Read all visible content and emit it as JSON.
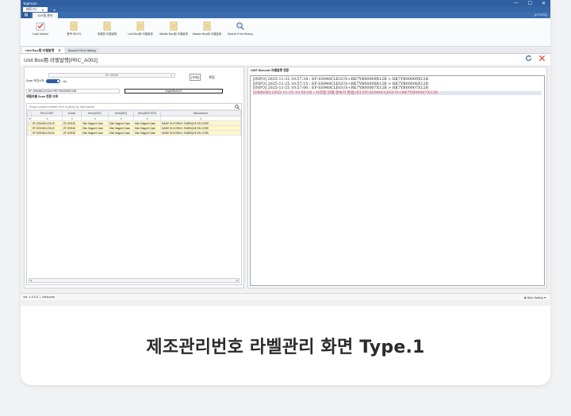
{
  "window": {
    "title": "TopFrom",
    "controls": [
      "—",
      "☐",
      "✕"
    ]
  },
  "doc_tabs": [
    {
      "label": "메모기1"
    }
  ],
  "ribbon_tab": "시스템 관리",
  "user": "(KTOPS)",
  "ribbon": [
    {
      "label": "Code Master",
      "icon": "check-doc-icon"
    },
    {
      "label": "품목 마스터",
      "icon": "doc-icon"
    },
    {
      "label": "제품別 라벨발행",
      "icon": "doc-icon"
    },
    {
      "label": "Unit Box用 라벨발행",
      "icon": "doc-icon"
    },
    {
      "label": "Middle Box用 라벨발행",
      "icon": "doc-icon"
    },
    {
      "label": "Master Box用 라벨발행",
      "icon": "doc-icon"
    },
    {
      "label": "Search Print History",
      "icon": "search-doc-icon"
    }
  ],
  "module_tabs": [
    {
      "label": "Unit Box用 라벨발행",
      "close": "✕"
    },
    {
      "label": "Search Print History"
    }
  ],
  "page": {
    "title": "Unit Box用 라벨발행[PRC_A002]"
  },
  "left": {
    "select_value": "EF-SS948",
    "scan_label": "Scan 작업시작",
    "toggle_state": "On",
    "view_btn": "[조회]",
    "edit_btn": "편집",
    "barcode_input": "EF-SS948CLEGUS+RK7YB00009X12B",
    "second_input": "simpleButton1",
    "section_title": "제품라벨 Scan 현황 조회",
    "group_hint": "Drag a column header here to group by that column",
    "columns": [
      "SKUCODE",
      "Model",
      "Item(UNIT)",
      "Item(MID)",
      "Item(MASTER)",
      "Manufacture"
    ],
    "filter_mark": "✢",
    "filter_row": "▼",
    "rows": [
      [
        "EF-SS948CLEGUS",
        "EF-SS948",
        "Slim Magnet Case",
        "Slim Magnet Case",
        "Slim Magnet Case",
        "MADE IN KOREA / FABRIQUE EN CORE"
      ],
      [
        "EF-SS948CLEGUS",
        "EF-SS948",
        "Slim Magnet Case",
        "Slim Magnet Case",
        "Slim Magnet Case",
        "MADE IN KOREA / FABRIQUE EN CORE"
      ],
      [
        "EF-SS948CLEGUS",
        "EF-SS948",
        "Slim Magnet Case",
        "Slim Magnet Case",
        "Slim Magnet Case",
        "MADE IN KOREA / FABRIQUE EN CORE"
      ]
    ],
    "scroll_left": "◂",
    "scroll_right": "▸"
  },
  "right": {
    "title": "UNIT Barcode 라벨발행 현황",
    "log": [
      {
        "text": "[INFO] 2025-11-25 10:57:34 : EF-SS948CLEGUS+RK7YB00009X12B > RK7YB00009X12B",
        "level": "info"
      },
      {
        "text": "[INFO] 2025-11-25 10:57:15 : EF-SS948CLEGUS+RK7YB00008X12B > RK7YB00008X12B",
        "level": "info"
      },
      {
        "text": "[INFO] 2025-11-25 10:57:06 : EF-SS948CLEGUS+RK7YB00007X12B > RK7YB00007X12B",
        "level": "info"
      },
      {
        "text": "[ERROR] 2025-11-25 10:56:58 : 시리얼 모델 정보가 틀립니다.EF-SS948CLEGUS+RK7YB00007X12B",
        "level": "error"
      }
    ]
  },
  "status": {
    "version": "Ver. 1.0.0.0",
    "welcome": "Welcome",
    "skin": "Skin Gallery"
  },
  "caption": "제조관리번호 라벨관리 화면 Type.1",
  "colors": {
    "accent": "#2f5fa0",
    "error": "#e23b3b",
    "refresh": "#2f5fa0",
    "close": "#e5412f"
  }
}
